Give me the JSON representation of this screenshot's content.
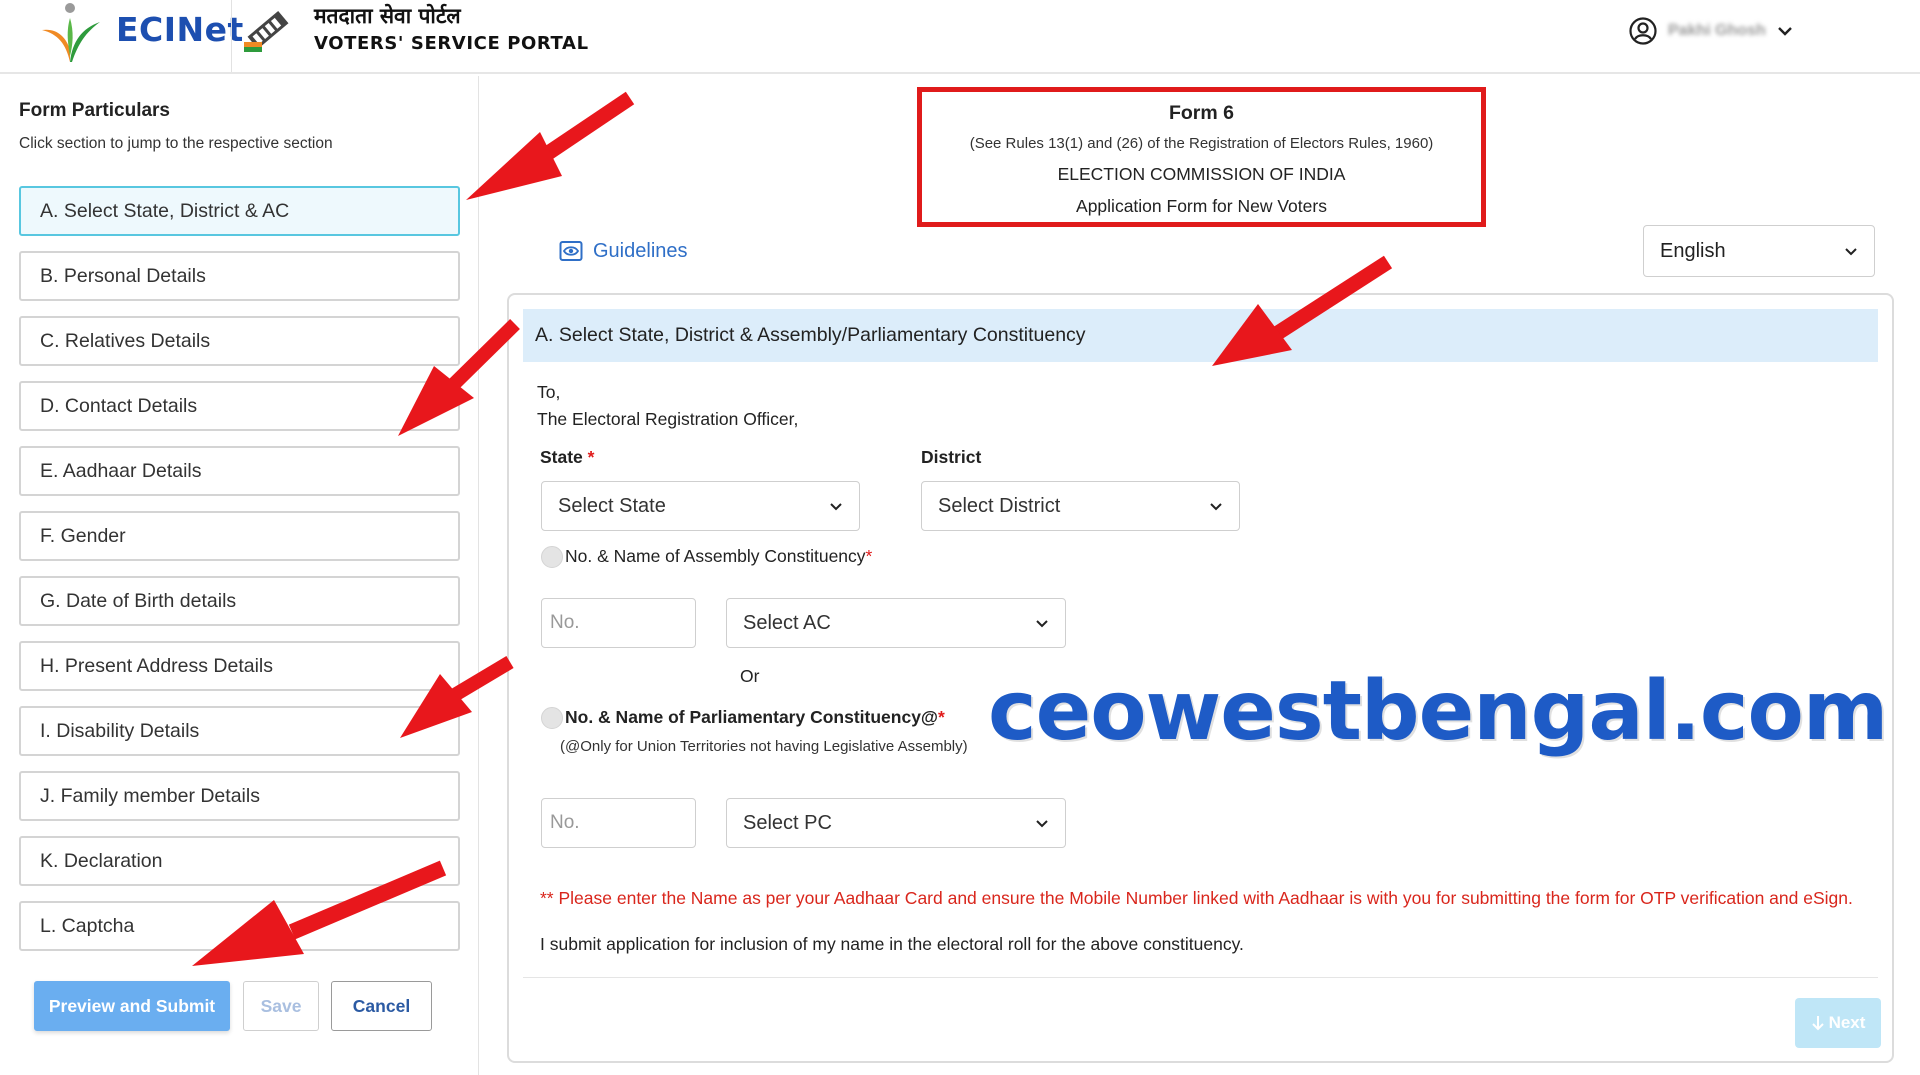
{
  "header": {
    "brand": "ECINet",
    "portal_hindi": "मतदाता सेवा पोर्टल",
    "portal_english": "VOTERS' SERVICE PORTAL",
    "user_name": "Pakhi Ghosh"
  },
  "sidebar": {
    "title": "Form Particulars",
    "subtitle": "Click section to jump to the respective section",
    "items": [
      {
        "label": "A. Select State, District & AC"
      },
      {
        "label": "B. Personal Details"
      },
      {
        "label": "C. Relatives Details"
      },
      {
        "label": "D. Contact Details"
      },
      {
        "label": "E. Aadhaar Details"
      },
      {
        "label": "F. Gender"
      },
      {
        "label": "G. Date of Birth details"
      },
      {
        "label": "H. Present Address Details"
      },
      {
        "label": "I. Disability Details"
      },
      {
        "label": "J. Family member Details"
      },
      {
        "label": "K. Declaration"
      },
      {
        "label": "L. Captcha"
      }
    ],
    "buttons": {
      "preview_submit": "Preview and Submit",
      "save": "Save",
      "cancel": "Cancel"
    }
  },
  "form_header": {
    "title": "Form 6",
    "rules": "(See Rules 13(1) and (26) of the Registration of Electors Rules, 1960)",
    "commission": "ELECTION COMMISSION OF INDIA",
    "application": "Application Form for New Voters"
  },
  "guidelines": "Guidelines",
  "language": {
    "selected": "English"
  },
  "section_a": {
    "heading": "A. Select State, District & Assembly/Parliamentary Constituency",
    "to_line1": "To,",
    "to_line2": "The Electoral Registration Officer,",
    "state_label": "State",
    "state_placeholder": "Select State",
    "district_label": "District",
    "district_placeholder": "Select District",
    "ac_label": "No. & Name of Assembly Constituency",
    "ac_no_placeholder": "No.",
    "ac_select": "Select AC",
    "or": "Or",
    "pc_label": "No. & Name of Parliamentary Constituency@",
    "pc_note": "(@Only for Union Territories not having Legislative Assembly)",
    "pc_no_placeholder": "No.",
    "pc_select": "Select PC",
    "warning": "** Please enter the Name as per your Aadhaar Card and ensure the Mobile Number linked with Aadhaar is with you for submitting the form for OTP verification and eSign.",
    "submit_statement": "I submit application for inclusion of my name in the electoral roll for the above constituency.",
    "next_label": "Next"
  },
  "watermark": "ceowestbengal.com",
  "colors": {
    "highlight_box": "#e01b1b",
    "arrow": "#e8171c",
    "section_head_bg": "#dcedfa",
    "brand_blue": "#1d4fb0",
    "warning_text": "#d9261c"
  }
}
